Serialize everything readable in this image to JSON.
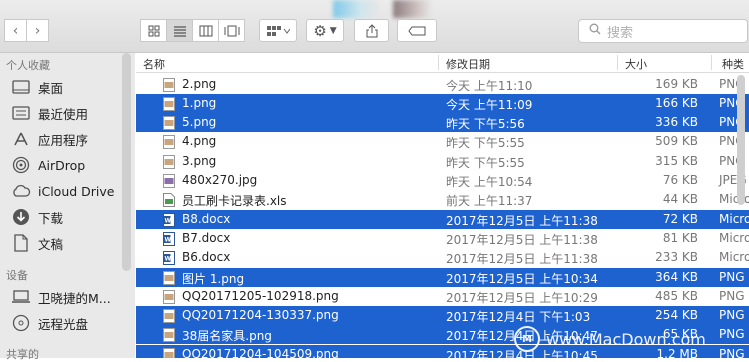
{
  "toolbar": {
    "back_icon": "chevron-left-icon",
    "forward_icon": "chevron-right-icon",
    "search_placeholder": "搜索"
  },
  "sidebar": {
    "favorites_title": "个人收藏",
    "favorites": [
      {
        "label": "桌面",
        "icon": "desktop-icon"
      },
      {
        "label": "最近使用",
        "icon": "recents-icon"
      },
      {
        "label": "应用程序",
        "icon": "applications-icon"
      },
      {
        "label": "AirDrop",
        "icon": "airdrop-icon"
      },
      {
        "label": "iCloud Drive",
        "icon": "cloud-icon"
      },
      {
        "label": "下载",
        "icon": "download-icon"
      },
      {
        "label": "文稿",
        "icon": "document-icon"
      }
    ],
    "devices_title": "设备",
    "devices": [
      {
        "label": "卫晓捷的M...",
        "icon": "computer-icon"
      },
      {
        "label": "远程光盘",
        "icon": "disc-icon"
      }
    ],
    "shared_title": "共享的"
  },
  "columns": {
    "name": "名称",
    "date": "修改日期",
    "size": "大小",
    "kind": "种类"
  },
  "files": [
    {
      "name": "2.png",
      "date": "今天 上午11:10",
      "size": "169 KB",
      "kind": "PNG",
      "selected": false,
      "type": "png"
    },
    {
      "name": "1.png",
      "date": "今天 上午11:09",
      "size": "166 KB",
      "kind": "PNG",
      "selected": true,
      "type": "png"
    },
    {
      "name": "5.png",
      "date": "昨天 下午5:56",
      "size": "336 KB",
      "kind": "PNG",
      "selected": true,
      "type": "png"
    },
    {
      "name": "4.png",
      "date": "昨天 下午5:55",
      "size": "509 KB",
      "kind": "PNG",
      "selected": false,
      "type": "png"
    },
    {
      "name": "3.png",
      "date": "昨天 下午5:55",
      "size": "315 KB",
      "kind": "PNG",
      "selected": false,
      "type": "png"
    },
    {
      "name": "480x270.jpg",
      "date": "昨天 上午10:54",
      "size": "76 KB",
      "kind": "JPEG",
      "selected": false,
      "type": "jpg"
    },
    {
      "name": "员工刷卡记录表.xls",
      "date": "前天 上午11:37",
      "size": "44 KB",
      "kind": "Micro",
      "selected": false,
      "type": "xls"
    },
    {
      "name": "B8.docx",
      "date": "2017年12月5日 上午11:38",
      "size": "72 KB",
      "kind": "Micro",
      "selected": true,
      "type": "docx"
    },
    {
      "name": "B7.docx",
      "date": "2017年12月5日 上午11:38",
      "size": "81 KB",
      "kind": "Micro",
      "selected": false,
      "type": "docx"
    },
    {
      "name": "B6.docx",
      "date": "2017年12月5日 上午11:38",
      "size": "233 KB",
      "kind": "Micro",
      "selected": false,
      "type": "docx"
    },
    {
      "name": "图片 1.png",
      "date": "2017年12月5日 上午10:34",
      "size": "364 KB",
      "kind": "PNG",
      "selected": true,
      "type": "png"
    },
    {
      "name": "QQ20171205-102918.png",
      "date": "2017年12月5日 上午10:29",
      "size": "485 KB",
      "kind": "PNG",
      "selected": false,
      "type": "png"
    },
    {
      "name": "QQ20171204-130337.png",
      "date": "2017年12月4日 下午1:03",
      "size": "254 KB",
      "kind": "PNG",
      "selected": true,
      "type": "png"
    },
    {
      "name": "38届名家具.png",
      "date": "2017年12月4日 上午10:47",
      "size": "65 KB",
      "kind": "PNG",
      "selected": true,
      "type": "png"
    },
    {
      "name": "QQ20171204-104509.png",
      "date": "2017年12月4日 上午10:45",
      "size": "1.2 MB",
      "kind": "PNG",
      "selected": true,
      "type": "png"
    }
  ],
  "watermark": {
    "text": "www.MacDown.com",
    "logo": "M"
  }
}
